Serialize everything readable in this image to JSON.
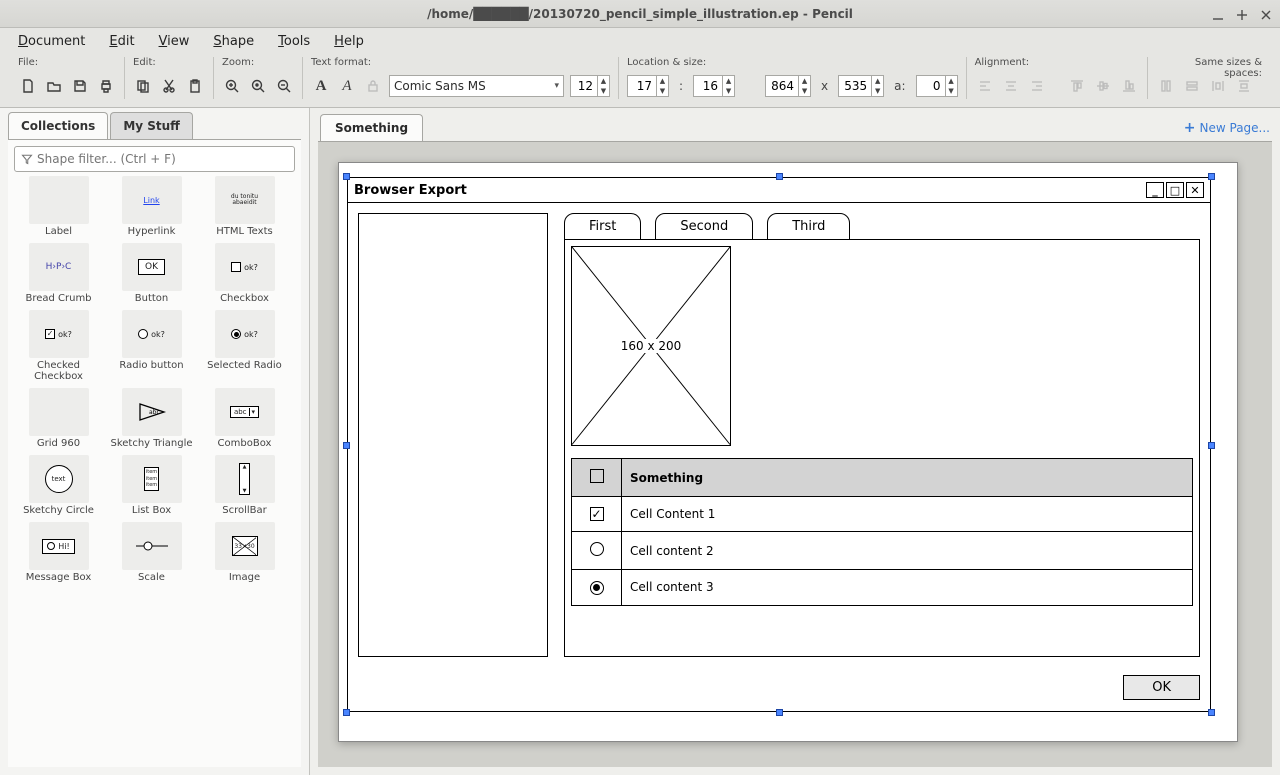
{
  "window": {
    "title": "/home/██████/20130720_pencil_simple_illustration.ep - Pencil"
  },
  "menubar": {
    "items": [
      "Document",
      "Edit",
      "View",
      "Shape",
      "Tools",
      "Help"
    ]
  },
  "toolbar": {
    "file_label": "File:",
    "edit_label": "Edit:",
    "zoom_label": "Zoom:",
    "text_label": "Text format:",
    "loc_label": "Location & size:",
    "align_label": "Alignment:",
    "sizes_label": "Same sizes & spaces:",
    "font": "Comic Sans MS",
    "font_size": "12",
    "loc_x": "17",
    "loc_y": "16",
    "size_w": "864",
    "size_h": "535",
    "angle_label": "a:",
    "angle": "0",
    "size_sep_colon": ":",
    "size_sep_x": "x"
  },
  "sidebar": {
    "tabs": {
      "collections": "Collections",
      "mystuff": "My Stuff"
    },
    "filter_placeholder": "Shape filter... (Ctrl + F)",
    "items": [
      {
        "name": "Label"
      },
      {
        "name": "Hyperlink"
      },
      {
        "name": "HTML Texts"
      },
      {
        "name": "Bread Crumb"
      },
      {
        "name": "Button"
      },
      {
        "name": "Checkbox"
      },
      {
        "name": "Checked Checkbox"
      },
      {
        "name": "Radio button"
      },
      {
        "name": "Selected Radio"
      },
      {
        "name": "Grid 960"
      },
      {
        "name": "Sketchy Triangle"
      },
      {
        "name": "ComboBox"
      },
      {
        "name": "Sketchy Circle"
      },
      {
        "name": "List Box"
      },
      {
        "name": "ScrollBar"
      },
      {
        "name": "Message Box"
      },
      {
        "name": "Scale"
      },
      {
        "name": "Image"
      }
    ],
    "thumbs": {
      "button": "OK",
      "checkbox": "ok?",
      "checked": "ok?",
      "radio": "ok?",
      "sradio": "ok?",
      "bcrumb": "H›P›C",
      "circle": "text",
      "combo": "abc ▾",
      "image": "33×30",
      "msg": "Hi!",
      "list": "item\nitem\nitem",
      "html": "du tonitu\nabaeidit",
      "label": "",
      "link": ""
    }
  },
  "canvas": {
    "tab": "Something",
    "newpage": "New Page..."
  },
  "mockup": {
    "title": "Browser Export",
    "tabs": [
      "First",
      "Second",
      "Third"
    ],
    "placeholder": "160 x 200",
    "table": {
      "header": "Something",
      "rows": [
        "Cell Content 1",
        "Cell content 2",
        "Cell content 3"
      ]
    },
    "ok": "OK"
  }
}
